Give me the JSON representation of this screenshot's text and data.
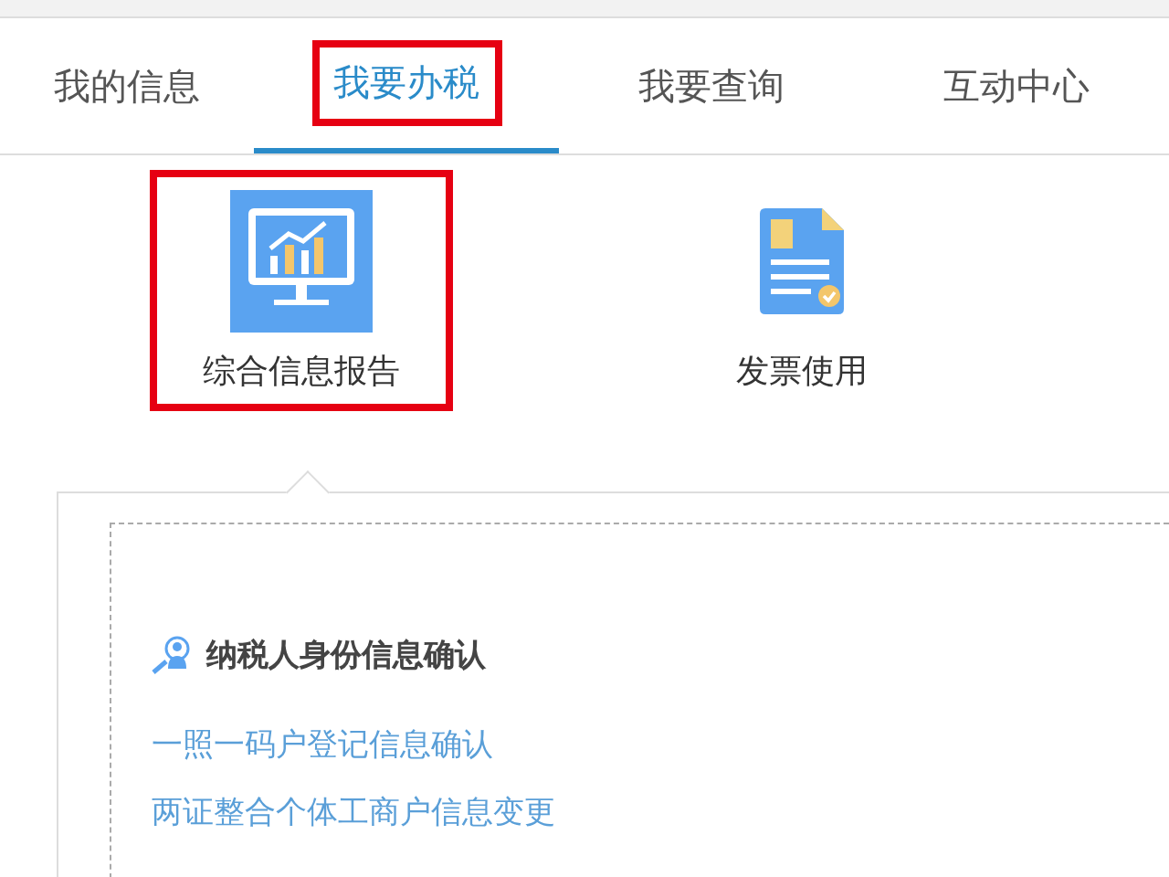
{
  "tabs": [
    {
      "label": "我的信息",
      "selected": false,
      "highlighted": false
    },
    {
      "label": "我要办税",
      "selected": true,
      "highlighted": true
    },
    {
      "label": "我要查询",
      "selected": false,
      "highlighted": false
    },
    {
      "label": "互动中心",
      "selected": false,
      "highlighted": false
    }
  ],
  "tiles": [
    {
      "kind": "monitor",
      "label": "综合信息报告",
      "selected": true,
      "highlighted": true
    },
    {
      "kind": "document",
      "label": "发票使用",
      "selected": false,
      "highlighted": false
    }
  ],
  "section": {
    "title": "纳税人身份信息确认",
    "links": [
      "一照一码户登记信息确认",
      "两证整合个体工商户信息变更"
    ]
  }
}
